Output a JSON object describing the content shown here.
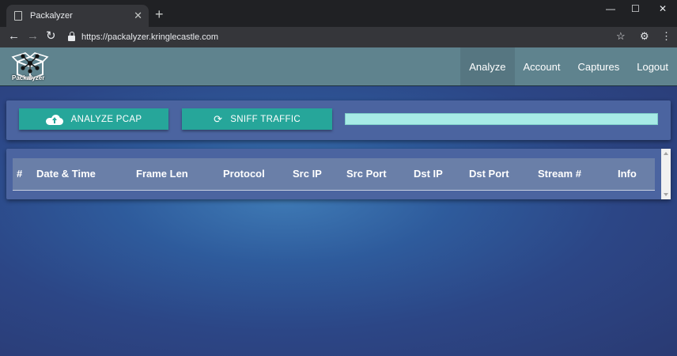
{
  "browser": {
    "tab_title": "Packalyzer",
    "tab_close": "✕",
    "new_tab": "+",
    "url": "https://packalyzer.kringlecastle.com",
    "window_controls": {
      "minimize": "—",
      "maximize": "☐",
      "close": "✕"
    }
  },
  "app": {
    "logo_text": "Packalyzer",
    "nav": [
      "Analyze",
      "Account",
      "Captures",
      "Logout"
    ],
    "active_nav": "Analyze"
  },
  "actions": {
    "analyze_label": "ANALYZE PCAP",
    "sniff_label": "SNIFF TRAFFIC",
    "progress_fraction": 1.0
  },
  "table": {
    "columns": [
      "#",
      "Date & Time",
      "Frame Len",
      "Protocol",
      "Src IP",
      "Src Port",
      "Dst IP",
      "Dst Port",
      "Stream #",
      "Info"
    ],
    "rows": []
  },
  "colors": {
    "accent": "#26a69a",
    "appbar": "#5f838e",
    "progress": "#a7ebe6"
  }
}
